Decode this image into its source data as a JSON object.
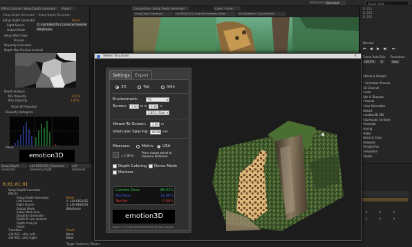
{
  "app": {
    "workspace_label": "Workspace:",
    "workspace_value": "Standard",
    "search_placeholder": "Search Help"
  },
  "left_panel": {
    "tabs": [
      "Effect Controls: Setup Depth Generator",
      "Project"
    ],
    "title": "Setup Depth Generator • Setup Depth Generator",
    "rows": [
      {
        "label": "Setup Depth Generator",
        "value": "Reset"
      },
      {
        "label": "Right Source",
        "value": "2. x3d RESULTS | Corrected Geometry Right"
      },
      {
        "label": "Output Mode",
        "value": "Wireframe"
      },
      {
        "label": "Setup Work Area",
        "value": ""
      },
      {
        "label": "Process",
        "value": ""
      },
      {
        "label": "Disparity Generator",
        "value": ""
      },
      {
        "label": "Depth Map Preview (scaled)",
        "value": ""
      }
    ],
    "analysis_rows": [
      {
        "label": "Depth Analysis",
        "value": ""
      },
      {
        "label": "Min Disparity",
        "value": "-1.07%"
      },
      {
        "label": "Max Disparity",
        "value": "1.07%"
      },
      {
        "label": "Show 3D Visualizer",
        "value": ""
      },
      {
        "label": "Disparity Histogram",
        "value": ""
      }
    ],
    "about_label": "About",
    "logo_text": "emotion3D"
  },
  "comp": {
    "tabs": [
      "Composition: Setup Depth Generator",
      "Layer: (none)"
    ],
    "subtabs": [
      "Setup Depth Generator",
      "x3d RESULTS | Corrected Geometry Right",
      "x3d Eastwood • Source Right"
    ]
  },
  "right_panel": {
    "info_rows": [
      "R: 255",
      "G: 255",
      "B: 255"
    ],
    "preview_title": "Preview",
    "preview_options": [
      "Frame Rate",
      "Skip",
      "Resolution"
    ],
    "preview_values": [
      "(29.97)",
      "0",
      "Auto"
    ],
    "effects_title": "Effects & Presets",
    "effects_list": [
      "* Animation Presets",
      "3D Channel",
      "Audio",
      "Blur & Sharpen",
      "Channel",
      "Color Correction",
      "Distort",
      "emotion3D SDI",
      "Expression Controls",
      "Generate",
      "Keying",
      "Matte",
      "Noise & Grain",
      "Obsolete",
      "Perspective",
      "Simulation",
      "Stylize"
    ]
  },
  "timeline": {
    "time": "0;01;01;01",
    "tabs": [
      "Setup Depth Generator",
      "x3d RESULTS | Corrected Geometry Right",
      "x3d Eastwood"
    ],
    "layers": [
      {
        "label": "Setup Depth Generator",
        "value": ""
      },
      {
        "label": "Effects",
        "value": ""
      },
      {
        "label": "Setup Depth Generator",
        "value": "Reset"
      },
      {
        "label": "Left Source",
        "value": "2. x3d RESULTS"
      },
      {
        "label": "Right Source",
        "value": "2. x3d RESULTS"
      },
      {
        "label": "Output Mode",
        "value": "Wireframe"
      },
      {
        "label": "Setup Work Area",
        "value": ""
      },
      {
        "label": "Disparity Generator",
        "value": ""
      },
      {
        "label": "Depth M..iew (scaled)",
        "value": ""
      },
      {
        "label": "Depth Analysis",
        "value": ""
      },
      {
        "label": "About",
        "value": ""
      },
      {
        "label": "Transform",
        "value": "Reset"
      },
      {
        "label": "x3d RES...ultry Left",
        "value": "None"
      },
      {
        "label": "x3d RES...ultry Right",
        "value": "None"
      }
    ],
    "toggle_label": "Toggle Switches / Modes"
  },
  "visualizer": {
    "title": "Stereo Visualizer",
    "close_glyph": "×",
    "tabs": [
      "Settings",
      "Export"
    ],
    "view_modes": [
      "3D",
      "Top",
      "Side"
    ],
    "view_selected": 0,
    "environment_label": "Environment:",
    "environment_value": "TV",
    "screen_label": "Screen:",
    "screen_width": "1.00",
    "screen_x": "x",
    "screen_height": "0.56",
    "screen_unit": "m",
    "aspect_value": "1.85:1 (Flat)",
    "viewer_label": "Viewer-To-Screen:",
    "viewer_value": "2.00",
    "viewer_unit": "m",
    "intercular_label": "Intercular Spacing:",
    "intercular_value": "65.00",
    "intercular_unit": "mm",
    "measure_label": "Measure:",
    "measure_options": [
      "Metric",
      "USA"
    ],
    "measure_selected": 1,
    "distance_value": "= 1.00 m",
    "distance_hint": "Press mouse wheel to measure distances",
    "checkboxes": [
      "Depth Coloring",
      "Demo Mode",
      "Markers"
    ],
    "stats": [
      {
        "label": "Comfort Zone:",
        "value": "88.02%",
        "color": "#2fc04a"
      },
      {
        "label": "Too Near:",
        "value": "11.98%",
        "color": "#3a5be0"
      },
      {
        "label": "Too Far:",
        "value": "0.00%",
        "color": "#e03a3a"
      }
    ],
    "logo_text": "emotion3D",
    "footer": "Version: 1.2, ©2012 emotion3D.GmbH. All rights reserved."
  },
  "colors": {
    "accent_orange": "#d98b2b",
    "comfort_green": "#2fc04a",
    "near_blue": "#3a5be0",
    "far_red": "#e03a3a"
  }
}
